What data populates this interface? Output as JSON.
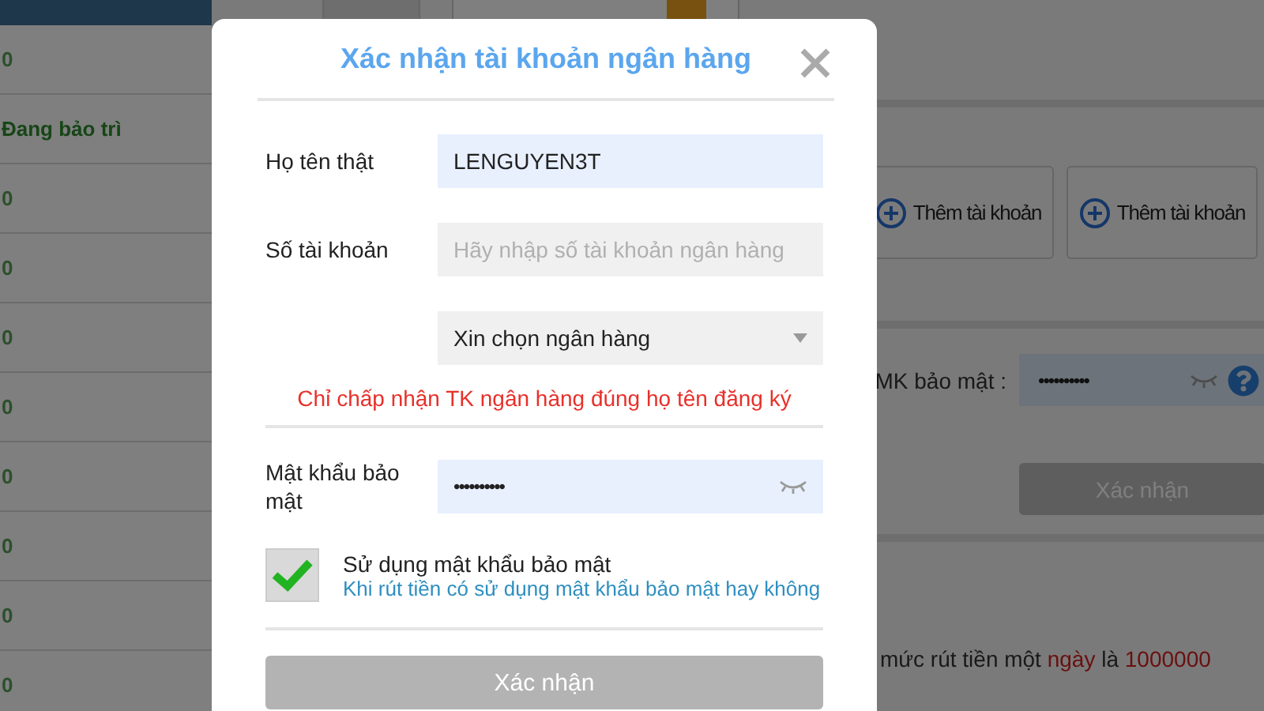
{
  "sidebar": {
    "items": [
      {
        "text": "0",
        "kind": "value"
      },
      {
        "text": "Đang bảo trì",
        "kind": "status"
      },
      {
        "text": "0",
        "kind": "value"
      },
      {
        "text": "0",
        "kind": "value"
      },
      {
        "text": "0",
        "kind": "value"
      },
      {
        "text": "0",
        "kind": "value"
      },
      {
        "text": "0",
        "kind": "value"
      },
      {
        "text": "0",
        "kind": "value"
      },
      {
        "text": "0",
        "kind": "value"
      },
      {
        "text": "0",
        "kind": "value"
      }
    ]
  },
  "page": {
    "account_buttons": [
      {
        "label": "Thêm tài khoản"
      },
      {
        "label": "Thêm tài khoản"
      }
    ],
    "security": {
      "label": "MK bảo mật :",
      "value": "••••••••••"
    },
    "confirm_button": {
      "label": "Xác nhận",
      "disabled": true
    },
    "limit_note": [
      {
        "text": "mức rút tiền một ",
        "highlight": false
      },
      {
        "text": "ngày",
        "highlight": true
      },
      {
        "text": " là ",
        "highlight": false
      },
      {
        "text": "1000000",
        "highlight": true
      }
    ]
  },
  "dialog": {
    "title": "Xác nhận tài khoản ngân hàng",
    "fields": [
      {
        "kind": "text",
        "label": "Họ tên thật",
        "value": "LENGUYEN3T"
      },
      {
        "kind": "text",
        "label": "Số tài khoản",
        "placeholder": "Hãy nhập số tài khoản ngân hàng"
      },
      {
        "kind": "select",
        "value": "Xin chọn ngân hàng"
      }
    ],
    "notice": "Chỉ chấp nhận TK ngân hàng đúng họ tên đăng ký",
    "password": {
      "label": "Mật khẩu bảo mật",
      "value": "••••••••••"
    },
    "use_password": {
      "checked": true,
      "label": "Sử dụng mật khẩu bảo mật",
      "hint": "Khi rút tiền có sử dụng mật khẩu bảo mật hay không"
    },
    "confirm_button": {
      "label": "Xác nhận",
      "disabled": true
    }
  }
}
